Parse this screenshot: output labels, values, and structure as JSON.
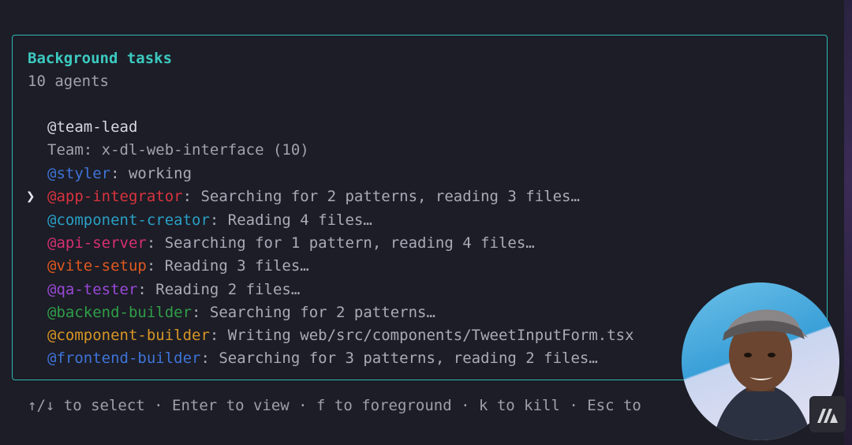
{
  "panel": {
    "title": "Background tasks",
    "subtitle": "10 agents",
    "lead": "@team-lead",
    "team_line": "Team: x-dl-web-interface (10)",
    "cursor_glyph": "❯",
    "agents": [
      {
        "name": "@styler",
        "status": ": working",
        "color": "#3f73d8"
      },
      {
        "name": "@app-integrator",
        "status": ": Searching for 2 patterns, reading 3 files…",
        "color": "#d9343f"
      },
      {
        "name": "@component-creator",
        "status": ": Reading 4 files…",
        "color": "#2a9fc5"
      },
      {
        "name": "@api-server",
        "status": ": Searching for 1 pattern, reading 4 files…",
        "color": "#d62f73"
      },
      {
        "name": "@vite-setup",
        "status": ": Reading 3 files…",
        "color": "#e0581f"
      },
      {
        "name": "@qa-tester",
        "status": ": Reading 2 files…",
        "color": "#9a48d6"
      },
      {
        "name": "@backend-builder",
        "status": ": Searching for 2 patterns…",
        "color": "#2f9e48"
      },
      {
        "name": "@component-builder",
        "status": ": Writing web/src/components/TweetInputForm.tsx",
        "color": "#d89525"
      },
      {
        "name": "@frontend-builder",
        "status": ": Searching for 3 patterns, reading 2 files…",
        "color": "#3f73d8"
      }
    ],
    "selected_index": 1
  },
  "footer": {
    "hint": "↑/↓ to select · Enter to view · f to foreground · k to kill · Esc to"
  }
}
